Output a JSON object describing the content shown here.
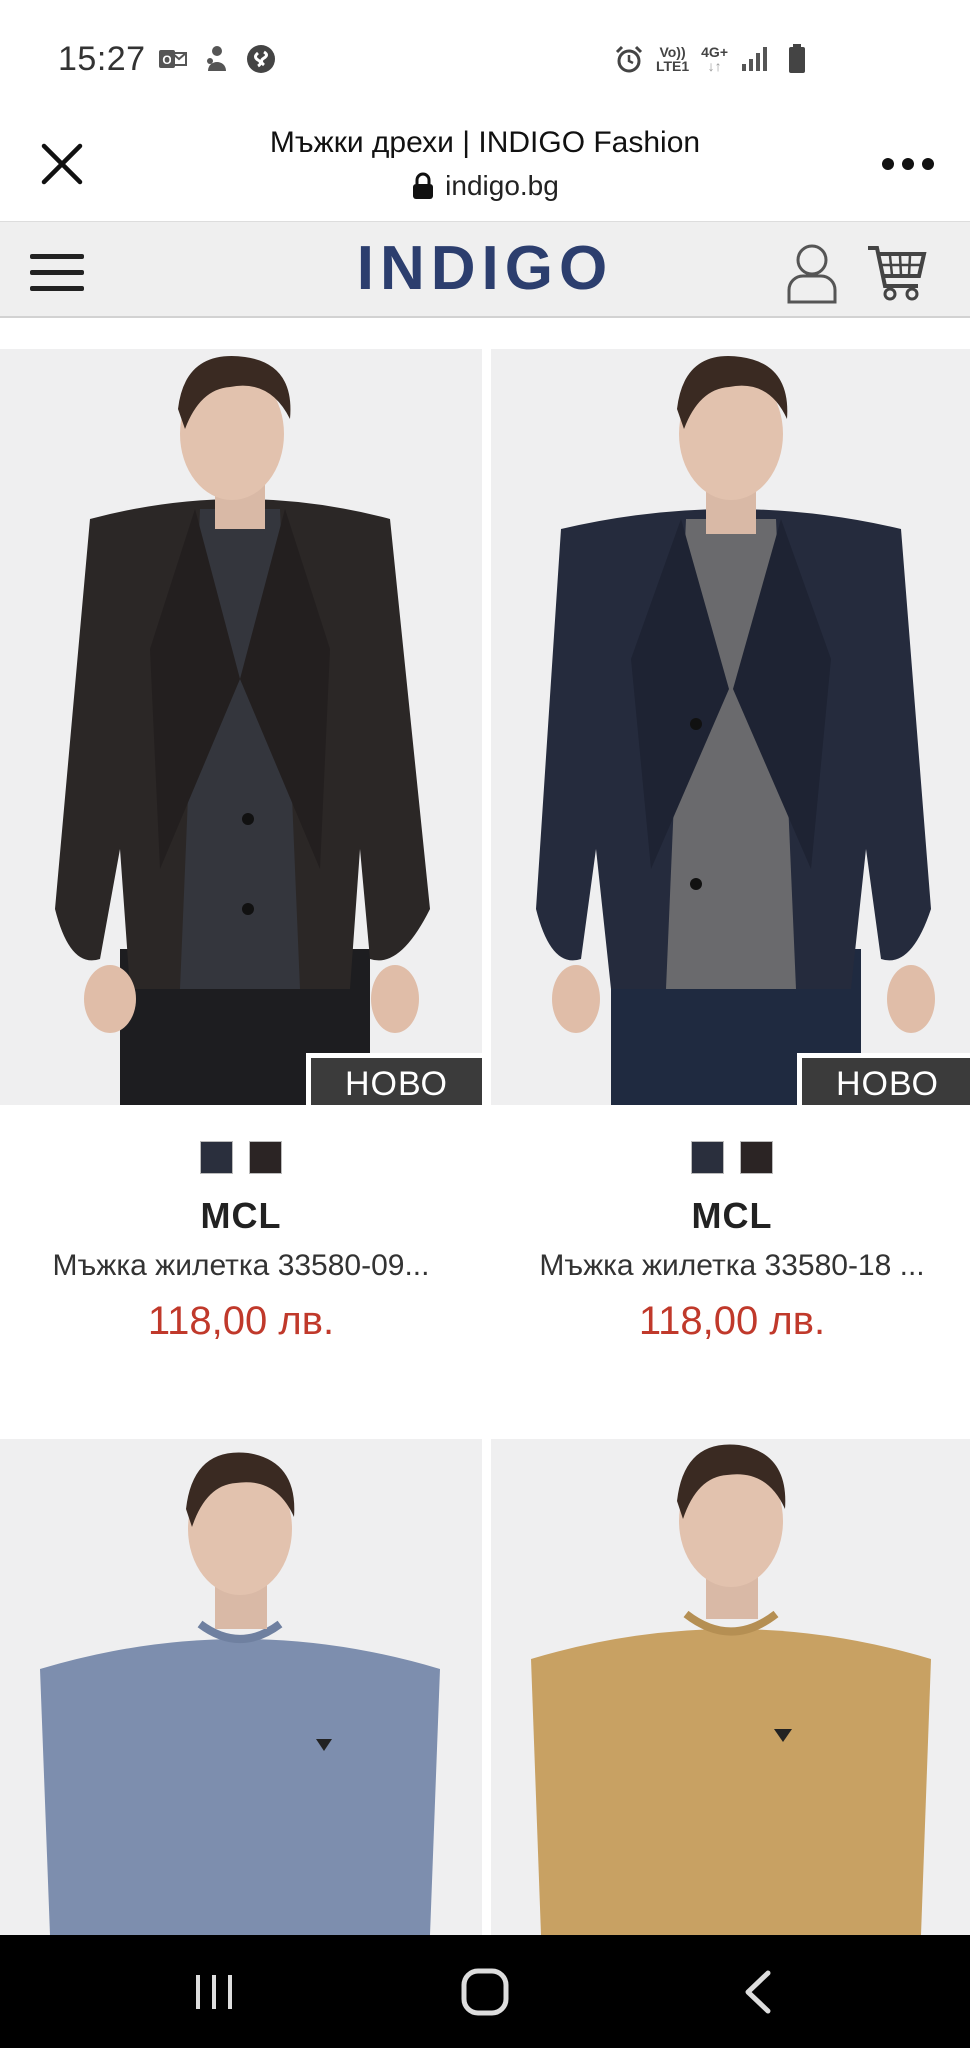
{
  "status": {
    "time": "15:27",
    "network_top": "Vo))",
    "network_bottom": "LTE1",
    "network_type_top": "4G+",
    "network_type_bottom": "↓↑"
  },
  "browser": {
    "title": "Мъжки дрехи | INDIGO Fashion",
    "url": "indigo.bg"
  },
  "site": {
    "logo": "INDIGO"
  },
  "products": [
    {
      "badge": "НОВО",
      "brand": "MCL",
      "name": "Мъжка жилетка 33580-09...",
      "price": "118,00 лв.",
      "swatches": [
        "#2a2f3d",
        "#2b2424"
      ],
      "garment_color": "#2b2726",
      "shirt_color": "#34363d"
    },
    {
      "badge": "НОВО",
      "brand": "MCL",
      "name": "Мъжка жилетка 33580-18 ...",
      "price": "118,00 лв.",
      "swatches": [
        "#2a2f3d",
        "#2b2424"
      ],
      "garment_color": "#252b3d",
      "shirt_color": "#6a6a6d"
    },
    {
      "garment_color": "#7d8eae"
    },
    {
      "garment_color": "#c8a163"
    }
  ]
}
